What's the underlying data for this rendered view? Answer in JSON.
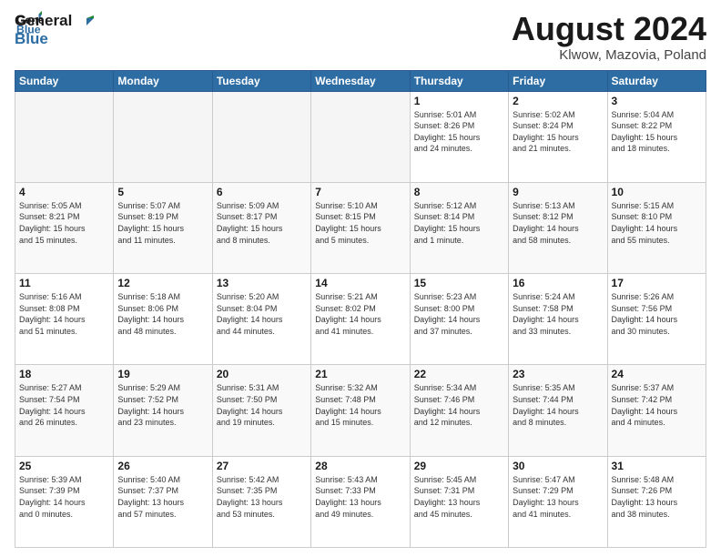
{
  "header": {
    "logo_line1": "General",
    "logo_line2": "Blue",
    "main_title": "August 2024",
    "subtitle": "Klwow, Mazovia, Poland"
  },
  "weekdays": [
    "Sunday",
    "Monday",
    "Tuesday",
    "Wednesday",
    "Thursday",
    "Friday",
    "Saturday"
  ],
  "weeks": [
    [
      {
        "day": "",
        "info": ""
      },
      {
        "day": "",
        "info": ""
      },
      {
        "day": "",
        "info": ""
      },
      {
        "day": "",
        "info": ""
      },
      {
        "day": "1",
        "info": "Sunrise: 5:01 AM\nSunset: 8:26 PM\nDaylight: 15 hours\nand 24 minutes."
      },
      {
        "day": "2",
        "info": "Sunrise: 5:02 AM\nSunset: 8:24 PM\nDaylight: 15 hours\nand 21 minutes."
      },
      {
        "day": "3",
        "info": "Sunrise: 5:04 AM\nSunset: 8:22 PM\nDaylight: 15 hours\nand 18 minutes."
      }
    ],
    [
      {
        "day": "4",
        "info": "Sunrise: 5:05 AM\nSunset: 8:21 PM\nDaylight: 15 hours\nand 15 minutes."
      },
      {
        "day": "5",
        "info": "Sunrise: 5:07 AM\nSunset: 8:19 PM\nDaylight: 15 hours\nand 11 minutes."
      },
      {
        "day": "6",
        "info": "Sunrise: 5:09 AM\nSunset: 8:17 PM\nDaylight: 15 hours\nand 8 minutes."
      },
      {
        "day": "7",
        "info": "Sunrise: 5:10 AM\nSunset: 8:15 PM\nDaylight: 15 hours\nand 5 minutes."
      },
      {
        "day": "8",
        "info": "Sunrise: 5:12 AM\nSunset: 8:14 PM\nDaylight: 15 hours\nand 1 minute."
      },
      {
        "day": "9",
        "info": "Sunrise: 5:13 AM\nSunset: 8:12 PM\nDaylight: 14 hours\nand 58 minutes."
      },
      {
        "day": "10",
        "info": "Sunrise: 5:15 AM\nSunset: 8:10 PM\nDaylight: 14 hours\nand 55 minutes."
      }
    ],
    [
      {
        "day": "11",
        "info": "Sunrise: 5:16 AM\nSunset: 8:08 PM\nDaylight: 14 hours\nand 51 minutes."
      },
      {
        "day": "12",
        "info": "Sunrise: 5:18 AM\nSunset: 8:06 PM\nDaylight: 14 hours\nand 48 minutes."
      },
      {
        "day": "13",
        "info": "Sunrise: 5:20 AM\nSunset: 8:04 PM\nDaylight: 14 hours\nand 44 minutes."
      },
      {
        "day": "14",
        "info": "Sunrise: 5:21 AM\nSunset: 8:02 PM\nDaylight: 14 hours\nand 41 minutes."
      },
      {
        "day": "15",
        "info": "Sunrise: 5:23 AM\nSunset: 8:00 PM\nDaylight: 14 hours\nand 37 minutes."
      },
      {
        "day": "16",
        "info": "Sunrise: 5:24 AM\nSunset: 7:58 PM\nDaylight: 14 hours\nand 33 minutes."
      },
      {
        "day": "17",
        "info": "Sunrise: 5:26 AM\nSunset: 7:56 PM\nDaylight: 14 hours\nand 30 minutes."
      }
    ],
    [
      {
        "day": "18",
        "info": "Sunrise: 5:27 AM\nSunset: 7:54 PM\nDaylight: 14 hours\nand 26 minutes."
      },
      {
        "day": "19",
        "info": "Sunrise: 5:29 AM\nSunset: 7:52 PM\nDaylight: 14 hours\nand 23 minutes."
      },
      {
        "day": "20",
        "info": "Sunrise: 5:31 AM\nSunset: 7:50 PM\nDaylight: 14 hours\nand 19 minutes."
      },
      {
        "day": "21",
        "info": "Sunrise: 5:32 AM\nSunset: 7:48 PM\nDaylight: 14 hours\nand 15 minutes."
      },
      {
        "day": "22",
        "info": "Sunrise: 5:34 AM\nSunset: 7:46 PM\nDaylight: 14 hours\nand 12 minutes."
      },
      {
        "day": "23",
        "info": "Sunrise: 5:35 AM\nSunset: 7:44 PM\nDaylight: 14 hours\nand 8 minutes."
      },
      {
        "day": "24",
        "info": "Sunrise: 5:37 AM\nSunset: 7:42 PM\nDaylight: 14 hours\nand 4 minutes."
      }
    ],
    [
      {
        "day": "25",
        "info": "Sunrise: 5:39 AM\nSunset: 7:39 PM\nDaylight: 14 hours\nand 0 minutes."
      },
      {
        "day": "26",
        "info": "Sunrise: 5:40 AM\nSunset: 7:37 PM\nDaylight: 13 hours\nand 57 minutes."
      },
      {
        "day": "27",
        "info": "Sunrise: 5:42 AM\nSunset: 7:35 PM\nDaylight: 13 hours\nand 53 minutes."
      },
      {
        "day": "28",
        "info": "Sunrise: 5:43 AM\nSunset: 7:33 PM\nDaylight: 13 hours\nand 49 minutes."
      },
      {
        "day": "29",
        "info": "Sunrise: 5:45 AM\nSunset: 7:31 PM\nDaylight: 13 hours\nand 45 minutes."
      },
      {
        "day": "30",
        "info": "Sunrise: 5:47 AM\nSunset: 7:29 PM\nDaylight: 13 hours\nand 41 minutes."
      },
      {
        "day": "31",
        "info": "Sunrise: 5:48 AM\nSunset: 7:26 PM\nDaylight: 13 hours\nand 38 minutes."
      }
    ]
  ]
}
